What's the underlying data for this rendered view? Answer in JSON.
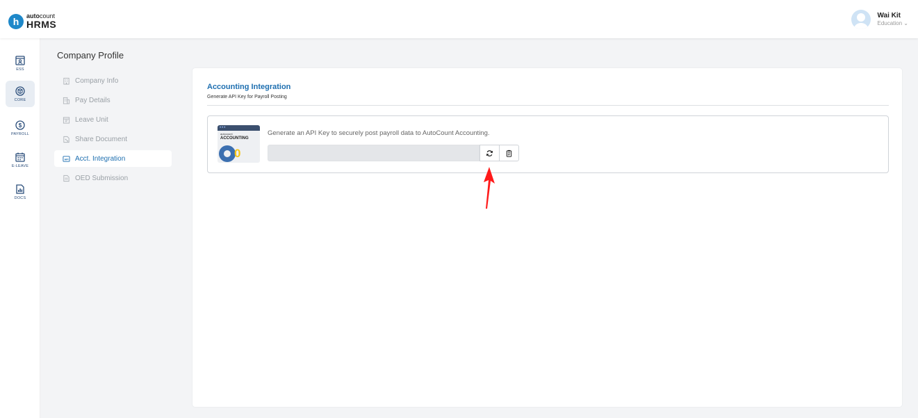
{
  "header": {
    "logo_letter": "h",
    "logo_brand_bold": "auto",
    "logo_brand_rest": "count",
    "logo_product": "HRMS",
    "user_name": "Wai Kit",
    "user_org": "Education ⌄"
  },
  "iconbar": {
    "items": [
      {
        "label": "ESS",
        "icon": "user-card-icon",
        "active": false
      },
      {
        "label": "CORE",
        "icon": "cube-icon",
        "active": true
      },
      {
        "label": "PAYROLL",
        "icon": "dollar-icon",
        "active": false
      },
      {
        "label": "E-LEAVE",
        "icon": "calendar-icon",
        "active": false
      },
      {
        "label": "DOCS",
        "icon": "document-chart-icon",
        "active": false
      }
    ]
  },
  "submenu": {
    "title": "Company Profile",
    "items": [
      {
        "label": "Company Info",
        "icon": "building-icon",
        "active": false
      },
      {
        "label": "Pay Details",
        "icon": "building-icon",
        "active": false
      },
      {
        "label": "Leave Unit",
        "icon": "calendar-icon",
        "active": false
      },
      {
        "label": "Share Document",
        "icon": "share-document-icon",
        "active": false
      },
      {
        "label": "Acct. Integration",
        "icon": "api-icon",
        "active": true
      },
      {
        "label": "OED Submission",
        "icon": "document-icon",
        "active": false
      }
    ]
  },
  "main": {
    "section_title": "Accounting Integration",
    "section_subtitle": "Generate API Key for Payroll Posting",
    "thumbnail": {
      "dots": "•••",
      "brand": "autocount",
      "product": "ACCOUNTING",
      "coin": "0"
    },
    "description": "Generate an API Key to securely post payroll data to AutoCount Accounting.",
    "api_key_value": "",
    "refresh_icon": "refresh-icon",
    "copy_icon": "clipboard-icon"
  },
  "annotation": {
    "color": "#ff0000",
    "icon": "red-arrow"
  },
  "colors": {
    "accent": "#1e6fb0",
    "brand": "#1e88c9",
    "background": "#f3f4f6"
  }
}
